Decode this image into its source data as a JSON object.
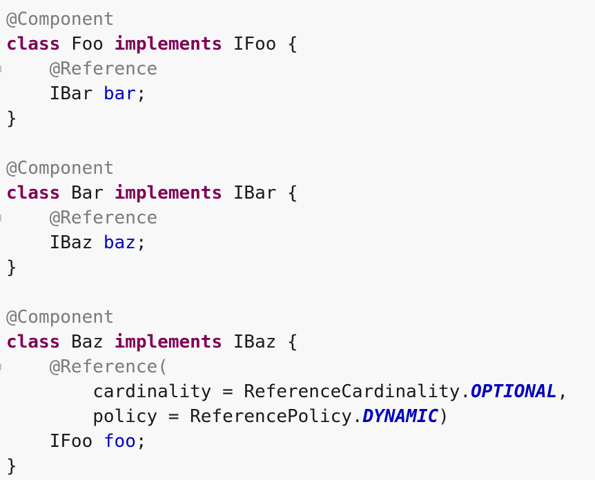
{
  "code": {
    "block1": {
      "annotation": "@Component",
      "kw_class": "class",
      "class_name": "Foo",
      "kw_implements": "implements",
      "interface": "IFoo",
      "open_brace": "{",
      "field_annotation": "@Reference",
      "field_type": "IBar",
      "field_name": "bar",
      "semicolon": ";",
      "close_brace": "}"
    },
    "block2": {
      "annotation": "@Component",
      "kw_class": "class",
      "class_name": "Bar",
      "kw_implements": "implements",
      "interface": "IBar",
      "open_brace": "{",
      "field_annotation": "@Reference",
      "field_type": "IBaz",
      "field_name": "baz",
      "semicolon": ";",
      "close_brace": "}"
    },
    "block3": {
      "annotation": "@Component",
      "kw_class": "class",
      "class_name": "Baz",
      "kw_implements": "implements",
      "interface": "IBaz",
      "open_brace": "{",
      "field_annotation": "@Reference(",
      "param1_prefix": "cardinality = ReferenceCardinality.",
      "param1_const": "OPTIONAL",
      "param1_suffix": ",",
      "param2_prefix": "policy = ReferencePolicy.",
      "param2_const": "DYNAMIC",
      "param2_suffix": ")",
      "field_type": "IFoo",
      "field_name": "foo",
      "semicolon": ";",
      "close_brace": "}"
    }
  }
}
